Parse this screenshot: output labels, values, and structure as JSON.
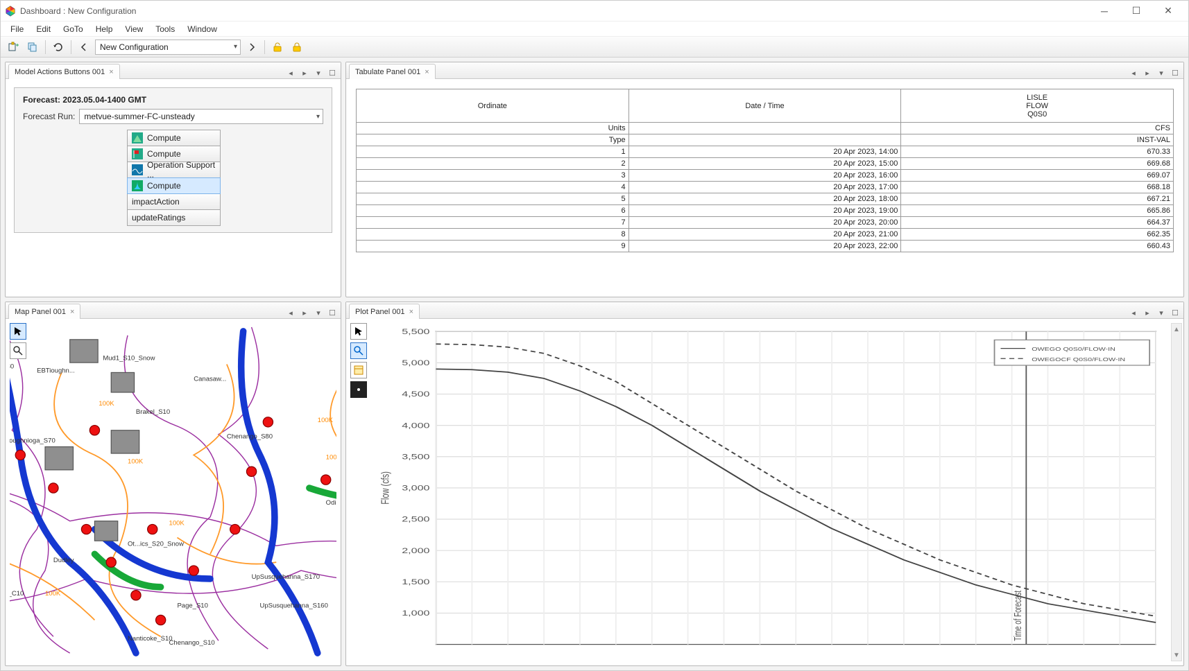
{
  "window": {
    "title": "Dashboard : New Configuration"
  },
  "menu": {
    "items": [
      "File",
      "Edit",
      "GoTo",
      "Help",
      "View",
      "Tools",
      "Window"
    ]
  },
  "toolbar": {
    "config_label": "New Configuration"
  },
  "panels": {
    "model_actions": {
      "tab": "Model Actions Buttons 001",
      "forecast_label": "Forecast: 2023.05.04-1400 GMT",
      "run_label": "Forecast Run:",
      "run_value": "metvue-summer-FC-unsteady",
      "actions": [
        {
          "label": "Compute",
          "icon": "green"
        },
        {
          "label": "Compute",
          "icon": "flag"
        },
        {
          "label": "Operation Support ...",
          "icon": "wave"
        },
        {
          "label": "Compute",
          "icon": "river",
          "selected": true
        },
        {
          "label": "impactAction",
          "icon": "none"
        },
        {
          "label": "updateRatings",
          "icon": "none"
        }
      ]
    },
    "tabulate": {
      "tab": "Tabulate Panel 001",
      "headers": {
        "c1": "Ordinate",
        "c2": "Date / Time",
        "c3_lines": [
          "LISLE",
          "FLOW",
          "Q0S0"
        ]
      },
      "units_row": {
        "label": "Units",
        "c3": "CFS"
      },
      "type_row": {
        "label": "Type",
        "c3": "INST-VAL"
      },
      "rows": [
        {
          "n": "1",
          "dt": "20 Apr 2023, 14:00",
          "v": "670.33"
        },
        {
          "n": "2",
          "dt": "20 Apr 2023, 15:00",
          "v": "669.68"
        },
        {
          "n": "3",
          "dt": "20 Apr 2023, 16:00",
          "v": "669.07"
        },
        {
          "n": "4",
          "dt": "20 Apr 2023, 17:00",
          "v": "668.18"
        },
        {
          "n": "5",
          "dt": "20 Apr 2023, 18:00",
          "v": "667.21"
        },
        {
          "n": "6",
          "dt": "20 Apr 2023, 19:00",
          "v": "665.86"
        },
        {
          "n": "7",
          "dt": "20 Apr 2023, 20:00",
          "v": "664.37"
        },
        {
          "n": "8",
          "dt": "20 Apr 2023, 21:00",
          "v": "662.35"
        },
        {
          "n": "9",
          "dt": "20 Apr 2023, 22:00",
          "v": "660.43"
        }
      ]
    },
    "map": {
      "tab": "Map Panel 001"
    },
    "plot": {
      "tab": "Plot Panel 001",
      "ylabel": "Flow (cfs)",
      "forecast_label": "Time of Forecast",
      "legend": [
        "OWEGO Q0S0/FLOW-IN",
        "OWEGOCF Q0S0/FLOW-IN"
      ]
    }
  },
  "chart_data": {
    "type": "line",
    "ylabel": "Flow (cfs)",
    "ylim": [
      500,
      5500
    ],
    "yticks": [
      1000,
      1500,
      2000,
      2500,
      3000,
      3500,
      4000,
      4500,
      5000,
      5500
    ],
    "x_range": [
      0,
      100
    ],
    "forecast_x": 82,
    "series": [
      {
        "name": "OWEGO Q0S0/FLOW-IN",
        "x": [
          0,
          5,
          10,
          15,
          20,
          25,
          30,
          35,
          40,
          45,
          50,
          55,
          60,
          65,
          70,
          75,
          80,
          85,
          90,
          95,
          100
        ],
        "y": [
          4900,
          4890,
          4850,
          4750,
          4550,
          4300,
          4000,
          3650,
          3300,
          2950,
          2650,
          2350,
          2100,
          1850,
          1650,
          1450,
          1300,
          1150,
          1050,
          950,
          850
        ]
      },
      {
        "name": "OWEGOCF Q0S0/FLOW-IN",
        "x": [
          0,
          5,
          10,
          15,
          20,
          25,
          30,
          35,
          40,
          45,
          50,
          55,
          60,
          65,
          70,
          75,
          80,
          85,
          90,
          95,
          100
        ],
        "y": [
          5300,
          5290,
          5250,
          5150,
          4950,
          4700,
          4350,
          4000,
          3650,
          3300,
          2950,
          2650,
          2350,
          2100,
          1850,
          1650,
          1450,
          1300,
          1150,
          1050,
          950
        ]
      }
    ],
    "legend": [
      "OWEGO Q0S0/FLOW-IN",
      "OWEGOCF Q0S0/FLOW-IN"
    ]
  }
}
